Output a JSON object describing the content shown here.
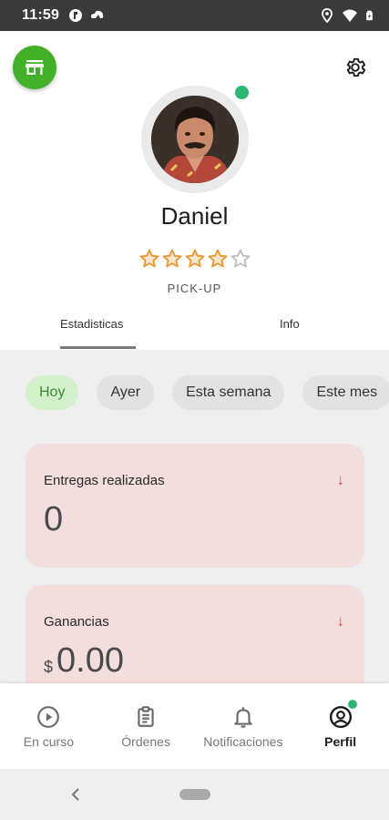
{
  "status_bar": {
    "time": "11:59",
    "left_icons": [
      "media-icon",
      "cloud-icon"
    ],
    "right_icons": [
      "location-icon",
      "wifi-icon",
      "battery-icon"
    ]
  },
  "header": {
    "store_icon": "store-icon",
    "settings_icon": "gear-icon"
  },
  "profile": {
    "name": "Daniel",
    "rating": 4,
    "rating_max": 5,
    "role": "PICK-UP",
    "online": true
  },
  "tabs": [
    {
      "label": "Estadisticas",
      "active": true
    },
    {
      "label": "Info",
      "active": false
    }
  ],
  "filters": [
    {
      "label": "Hoy",
      "active": true
    },
    {
      "label": "Ayer",
      "active": false
    },
    {
      "label": "Esta semana",
      "active": false
    },
    {
      "label": "Este mes",
      "active": false
    }
  ],
  "stats": {
    "deliveries": {
      "title": "Entregas realizadas",
      "value": "0",
      "trend_icon": "arrow-down-icon"
    },
    "earnings": {
      "title": "Ganancias",
      "currency": "$",
      "value": "0.00",
      "trend_icon": "arrow-down-icon"
    }
  },
  "bottom_nav": [
    {
      "label": "En curso",
      "icon": "play-circle-icon",
      "active": false
    },
    {
      "label": "Órdenes",
      "icon": "receipt-icon",
      "active": false
    },
    {
      "label": "Notificaciones",
      "icon": "bell-icon",
      "active": false
    },
    {
      "label": "Perfil",
      "icon": "user-circle-icon",
      "active": true,
      "badge": true
    }
  ],
  "colors": {
    "brand_green": "#43b02a",
    "online_green": "#2bb673",
    "star_orange": "#e8962f",
    "card_pink": "#f2dedd",
    "trend_red": "#e64a4a"
  }
}
